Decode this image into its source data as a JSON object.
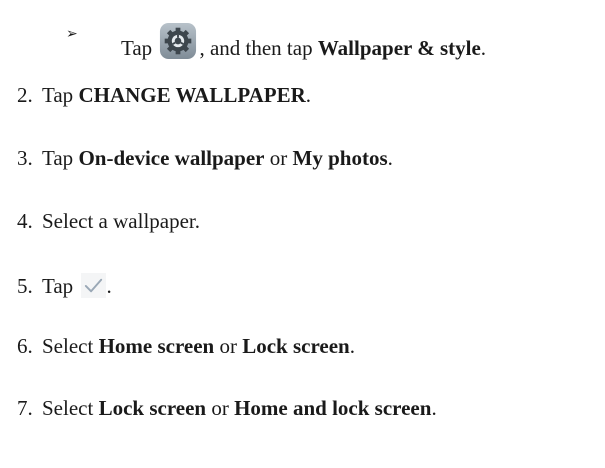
{
  "substep": {
    "marker": "➢",
    "tap": "Tap",
    "then": ", and then tap ",
    "target": "Wallpaper & style",
    "end": "."
  },
  "steps": [
    {
      "num": "2.",
      "a": "Tap ",
      "b1": "CHANGE WALLPAPER",
      "c": ".",
      "b2": "",
      "d": ""
    },
    {
      "num": "3.",
      "a": "Tap ",
      "b1": "On-device wallpaper",
      "c": " or ",
      "b2": "My photos",
      "d": "."
    },
    {
      "num": "4.",
      "a": "Select a wallpaper.",
      "b1": "",
      "c": "",
      "b2": "",
      "d": ""
    },
    {
      "num": "5.",
      "a": "Tap ",
      "b1": "",
      "c": ".",
      "b2": "",
      "d": ""
    },
    {
      "num": "6.",
      "a": "Select ",
      "b1": "Home screen",
      "c": " or ",
      "b2": "Lock screen",
      "d": "."
    },
    {
      "num": "7.",
      "a": "Select ",
      "b1": "Lock screen",
      "c": " or ",
      "b2": "Home and lock screen",
      "d": "."
    }
  ],
  "icons": {
    "settings": "settings-gear-icon",
    "confirm": "checkmark-icon",
    "settings_bg": "#9aa6b0",
    "check_color": "#9aa8b6"
  }
}
